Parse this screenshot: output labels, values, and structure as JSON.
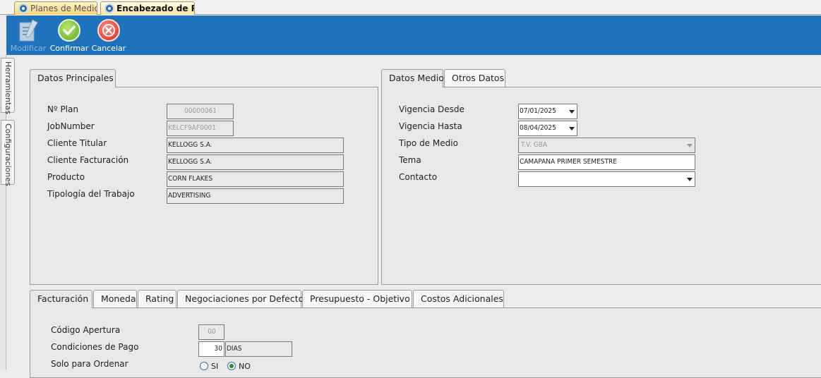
{
  "doc_tabs": [
    {
      "label": "Planes de Medios"
    },
    {
      "label": "Encabezado de Plan"
    }
  ],
  "toolbar": {
    "edit_label": "Modificar",
    "confirm_label": "Confirmar",
    "cancel_label": "Cancelar"
  },
  "side_tabs": {
    "tools": "Herramientas",
    "config": "Configuraciones"
  },
  "main": {
    "tab_label": "Datos Principales",
    "plan_no_label": "Nº Plan",
    "plan_no_value": "00000061",
    "jobnumber_label": "JobNumber",
    "jobnumber_value": "KELCF9AF0001",
    "cliente_titular_label": "Cliente Titular",
    "cliente_titular_value": "KELLOGG S.A.",
    "cliente_fact_label": "Cliente Facturación",
    "cliente_fact_value": "KELLOGG S.A.",
    "producto_label": "Producto",
    "producto_value": "CORN FLAKES",
    "tipologia_label": "Tipología del Trabajo",
    "tipologia_value": "ADVERTISING"
  },
  "medio": {
    "tabs": [
      "Datos Medio",
      "Otros Datos"
    ],
    "vig_desde_label": "Vigencia Desde",
    "vig_desde_value": "07/01/2025",
    "vig_hasta_label": "Vigencia Hasta",
    "vig_hasta_value": "08/04/2025",
    "tipo_medio_label": "Tipo de Medio",
    "tipo_medio_value": "T.V. GBA",
    "tema_label": "Tema",
    "tema_value": "CAMAPANA PRIMER SEMESTRE",
    "contacto_label": "Contacto",
    "contacto_value": ""
  },
  "bottom": {
    "tabs": [
      "Facturación",
      "Moneda",
      "Rating",
      "Negociaciones por Defecto",
      "Presupuesto - Objetivo",
      "Costos Adicionales"
    ],
    "codigo_label": "Código Apertura",
    "codigo_value": "00",
    "condiciones_label": "Condiciones de Pago",
    "condiciones_days": "30",
    "condiciones_unit": "DIAS",
    "solo_label": "Solo para Ordenar",
    "radio_si": "SI",
    "radio_no": "NO"
  }
}
